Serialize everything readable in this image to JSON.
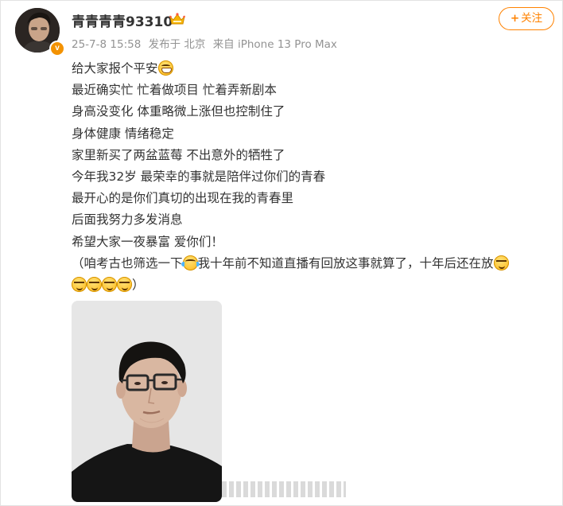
{
  "post": {
    "author": {
      "name": "青青青青93310",
      "avatar_icon": "avatar-photo",
      "verified_badge": "v",
      "vip_icon": "crown-icon"
    },
    "meta": {
      "time": "25-7-8 15:58",
      "location": "发布于 北京",
      "device": "来自 iPhone 13 Pro Max"
    },
    "follow_button": {
      "plus": "+",
      "label": "关注"
    },
    "lines": [
      {
        "text": "给大家报个平安",
        "emoji_after": "grin"
      },
      {
        "text": "最近确实忙 忙着做项目 忙着弄新剧本"
      },
      {
        "text": "身高没变化 体重略微上涨但也控制住了"
      },
      {
        "text": "身体健康 情绪稳定"
      },
      {
        "text": "家里新买了两盆蓝莓 不出意外的牺牲了"
      },
      {
        "text": "今年我32岁 最荣幸的事就是陪伴过你们的青春"
      },
      {
        "text": "最开心的是你们真切的出现在我的青春里"
      },
      {
        "text": "后面我努力多发消息"
      },
      {
        "text": "希望大家一夜暴富  爱你们！"
      }
    ],
    "paren_line": {
      "part1": "（咱考古也筛选一下",
      "part2": "我十年前不知道直播有回放这事就算了，十年后还在放"
    },
    "close_paren": "）",
    "photo": {
      "icon": "selfie-photo"
    }
  },
  "colors": {
    "accent": "#ff8200",
    "meta_text": "#939393",
    "body_text": "#333333",
    "badge": "#f39200"
  }
}
